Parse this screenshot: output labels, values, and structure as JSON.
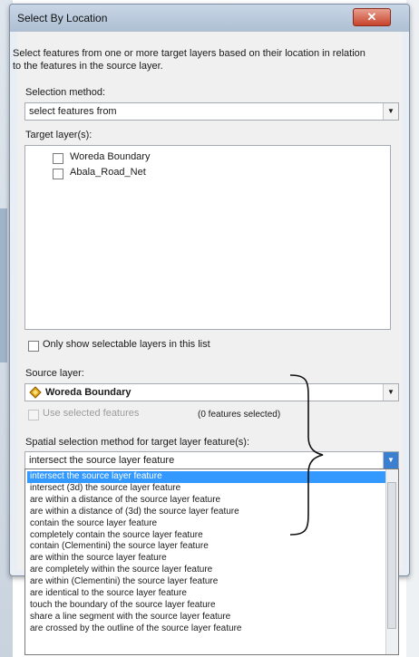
{
  "dialog": {
    "title": "Select By Location",
    "close_glyph": "✕",
    "intro": "Select features from one or more target layers based on their location in relation to the features in the source layer.",
    "selection_method_label": "Selection method:",
    "selection_method_value": "select features from",
    "target_layers_label": "Target layer(s):",
    "target_layers": [
      {
        "label": "Woreda Boundary",
        "checked": false
      },
      {
        "label": "Abala_Road_Net",
        "checked": false
      }
    ],
    "only_selectable_label": "Only show selectable layers in this list",
    "source_layer_label": "Source layer:",
    "source_layer_value": "Woreda Boundary",
    "source_layer_icon": "polygon-layer-icon",
    "use_selected_label": "Use selected features",
    "features_selected": "(0 features selected)",
    "spatial_method_label": "Spatial selection method for target layer feature(s):",
    "spatial_method_value": "intersect the source layer feature",
    "spatial_methods": [
      "intersect the source layer feature",
      "intersect (3d) the source layer feature",
      "are within a distance of the source layer feature",
      "are within a distance of (3d) the source layer feature",
      "contain the source layer feature",
      "completely contain the source layer feature",
      "contain (Clementini) the source layer feature",
      "are within the source layer feature",
      "are completely within the source layer feature",
      "are within (Clementini) the source layer feature",
      "are identical to the source layer feature",
      "touch the boundary of the source layer feature",
      "share a line segment with the source layer feature",
      "are crossed by the outline of the source layer feature"
    ],
    "selected_index": 0
  },
  "colors": {
    "selection": "#3399ff",
    "icon_fill": "#e3a51a",
    "brace": "#111111"
  }
}
